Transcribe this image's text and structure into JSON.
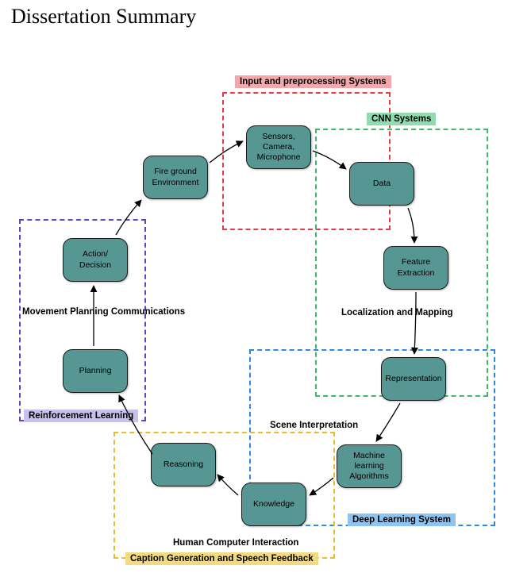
{
  "title": "Dissertation Summary",
  "nodes": {
    "env": "Fire ground Environment",
    "sensors": "Sensors, Camera, Microphone",
    "data": "Data",
    "featext": "Feature Extraction",
    "repr": "Representation",
    "ml": "Machine learning Algorithms",
    "knowledge": "Knowledge",
    "reasoning": "Reasoning",
    "planning": "Planning",
    "action": "Action/ Decision"
  },
  "regions": {
    "input": {
      "label": "Input and preprocessing Systems",
      "color": "#f07f84",
      "fill": "#f4a8ab"
    },
    "cnn": {
      "label": "CNN Systems",
      "color": "#3eb86b",
      "fill": "#8fdcb0"
    },
    "deep": {
      "label": "Deep Learning System",
      "color": "#2f88e6",
      "fill": "#8ec4f2"
    },
    "caption": {
      "label": "Caption Generation and Speech Feedback",
      "color": "#e6bb32",
      "fill": "#f3d97f"
    },
    "rl": {
      "label": "Reinforcement Learning",
      "color": "#5946c5",
      "fill": "#c7c1ec"
    }
  },
  "labels": {
    "locmap": "Localization and Mapping",
    "scene": "Scene Interpretation",
    "hci": "Human Computer Interaction",
    "move": "Movement Planning Communications"
  }
}
